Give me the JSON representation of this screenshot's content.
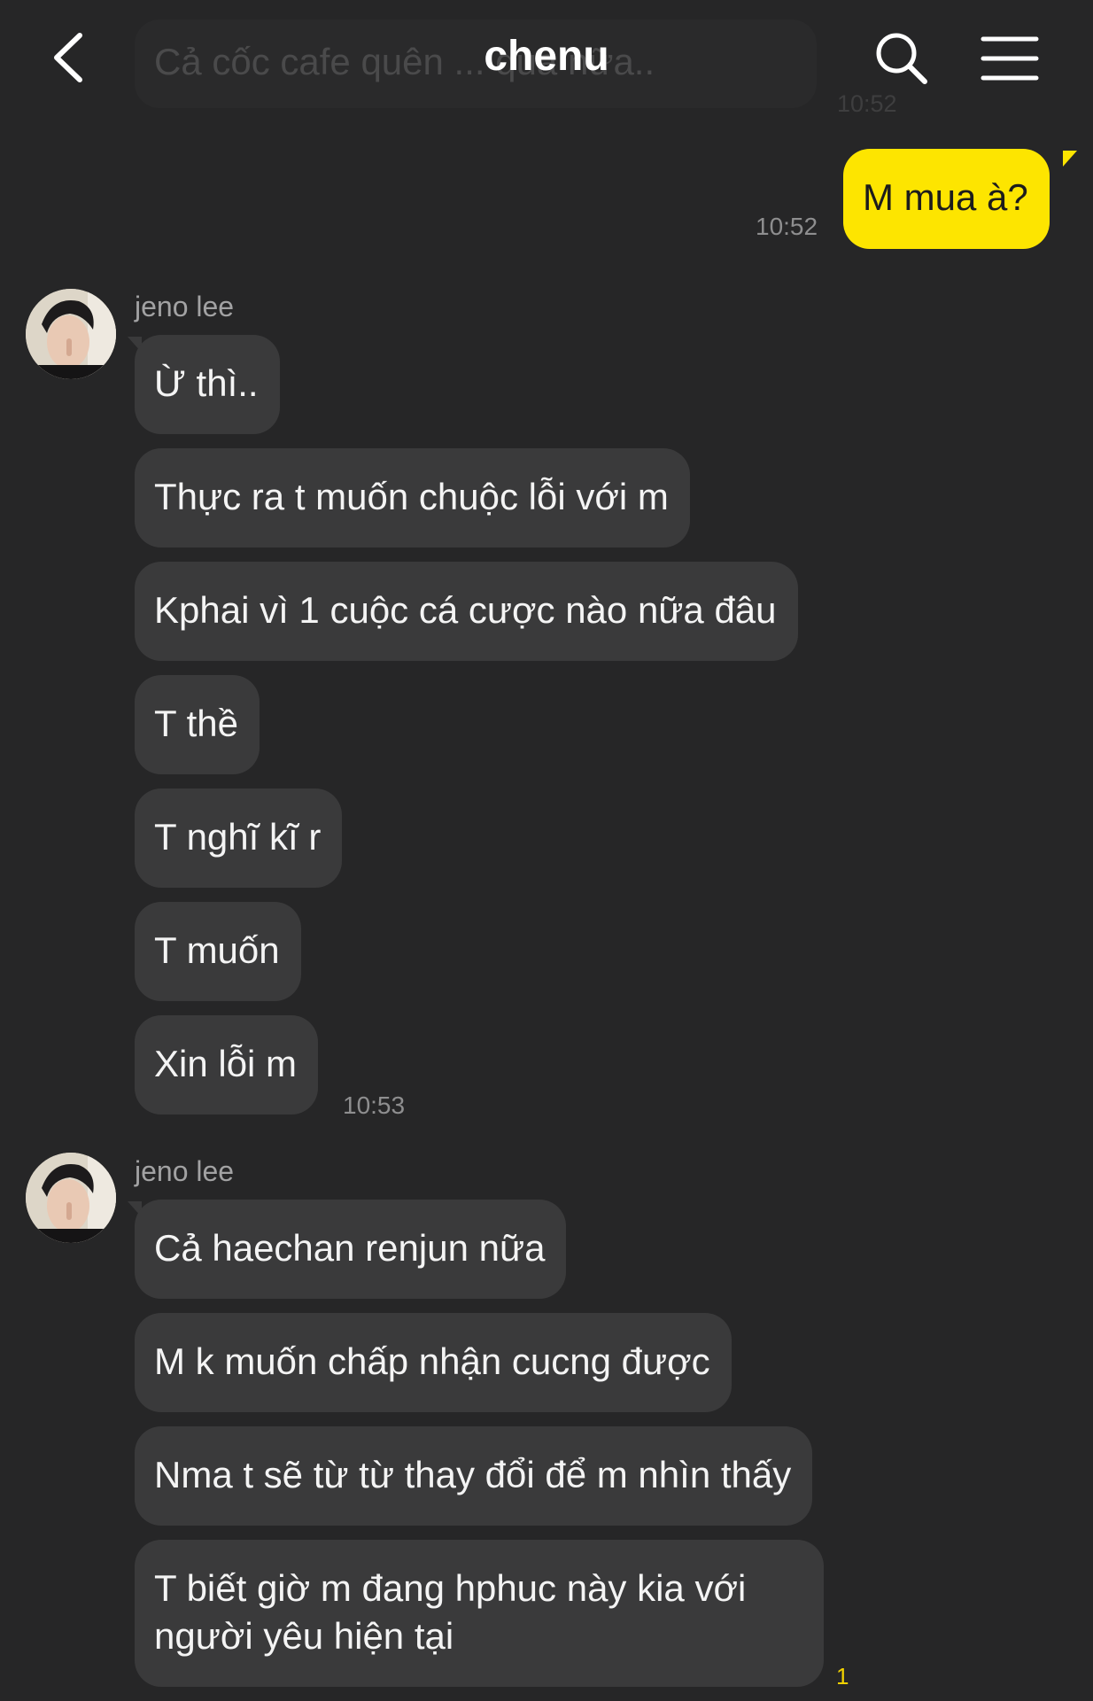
{
  "header": {
    "title": "chenu",
    "back_icon": "chevron-left-icon",
    "search_icon": "search-icon",
    "menu_icon": "hamburger-menu-icon",
    "ghost_preview_text": "Cả cốc cafe quên ... qua nữa..",
    "ghost_preview_time": "10:52"
  },
  "outgoing": {
    "text": "M mua à?",
    "time": "10:52"
  },
  "group1": {
    "sender": "jeno lee",
    "messages": [
      "Ừ thì..",
      "Thực ra t muốn chuộc lỗi với m",
      "Kphai vì 1 cuộc cá cược nào nữa đâu",
      "T thề",
      "T nghĩ kĩ r",
      "T muốn",
      "Xin lỗi m"
    ],
    "time": "10:53"
  },
  "group2": {
    "sender": "jeno lee",
    "messages": [
      "Cả haechan renjun nữa",
      "M k muốn chấp nhận cucng được",
      "Nma t sẽ từ từ thay đổi để m nhìn thấy",
      "T biết giờ m đang hphuc này kia với người yêu hiện tại"
    ],
    "unread": "1"
  },
  "colors": {
    "background": "#262627",
    "incoming_bubble": "#3a3a3b",
    "outgoing_bubble": "#fde500",
    "unread": "#f2d200"
  }
}
